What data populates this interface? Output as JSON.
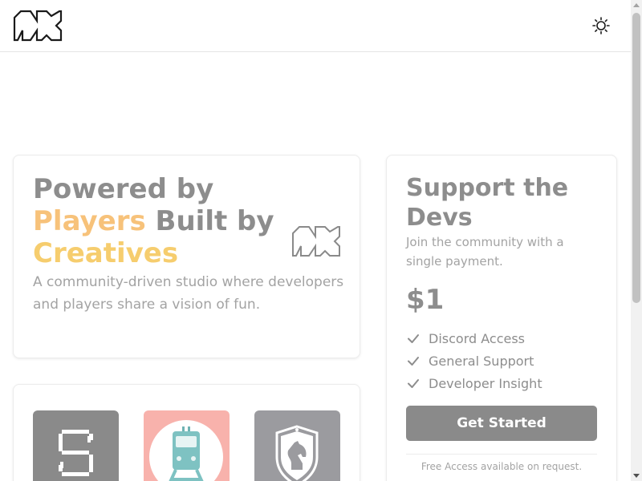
{
  "header": {
    "logo_icon": "studio-logo-icon",
    "theme_toggle_icon": "sun-icon"
  },
  "hero": {
    "title_part1": "Powered by ",
    "title_players": "Players",
    "title_part2": " Built by ",
    "title_creatives": "Creatives",
    "description": "A community-driven studio where developers and players share a vision of fun.",
    "logo_icon": "studio-logo-icon",
    "colors": {
      "players": "#f7c27a",
      "creatives": "#f6cd6e"
    }
  },
  "games": [
    {
      "icon": "pixel-s-icon",
      "color": "#8a8a8a"
    },
    {
      "icon": "train-icon",
      "color": "#f8b2ac"
    },
    {
      "icon": "knight-shield-icon",
      "color": "#9b9b9f"
    }
  ],
  "pricing": {
    "title": "Support the Devs",
    "subtitle": "Join the community with a single payment.",
    "price": "$1",
    "features": [
      "Discord Access",
      "General Support",
      "Developer Insight"
    ],
    "cta_label": "Get Started",
    "note": "Free Access available on request."
  }
}
